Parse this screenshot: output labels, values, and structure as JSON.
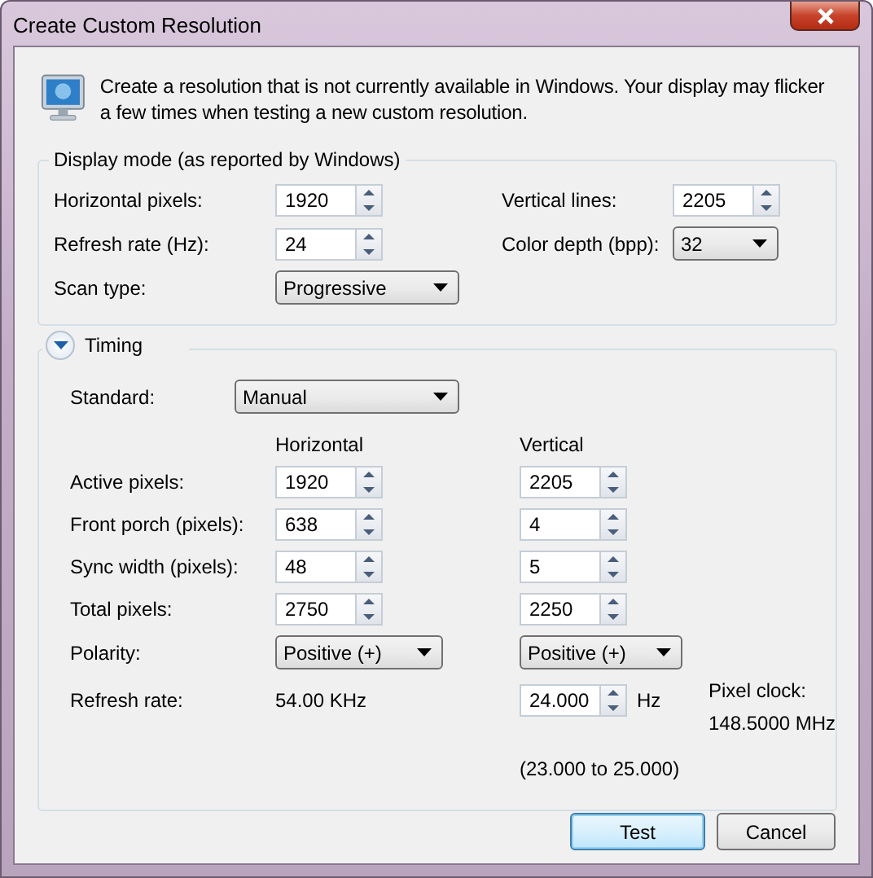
{
  "window": {
    "title": "Create Custom Resolution"
  },
  "intro": "Create a resolution that is not currently available in Windows. Your display may flicker a few times when testing a new custom resolution.",
  "display_mode": {
    "title": "Display mode (as reported by Windows)",
    "fields": [
      {
        "label": "Horizontal pixels:",
        "kind": "spin",
        "value": "1920"
      },
      {
        "label": "Vertical lines:",
        "kind": "spin",
        "value": "2205"
      },
      {
        "label": "Refresh rate (Hz):",
        "kind": "spin",
        "value": "24"
      },
      {
        "label": "Color depth (bpp):",
        "kind": "dropdown",
        "value": "32"
      },
      {
        "label": "Scan type:",
        "kind": "dropdown",
        "value": "Progressive"
      }
    ]
  },
  "timing": {
    "title": "Timing",
    "expanded": true,
    "standard": {
      "label": "Standard:",
      "value": "Manual"
    },
    "column_headers": [
      "Horizontal",
      "Vertical"
    ],
    "rows": [
      {
        "label": "Active pixels:",
        "cells": [
          {
            "kind": "spin",
            "value": "1920"
          },
          {
            "kind": "spin",
            "value": "2205"
          }
        ]
      },
      {
        "label": "Front porch (pixels):",
        "cells": [
          {
            "kind": "spin",
            "value": "638"
          },
          {
            "kind": "spin",
            "value": "4"
          }
        ]
      },
      {
        "label": "Sync width (pixels):",
        "cells": [
          {
            "kind": "spin",
            "value": "48"
          },
          {
            "kind": "spin",
            "value": "5"
          }
        ]
      },
      {
        "label": "Total pixels:",
        "cells": [
          {
            "kind": "spin",
            "value": "2750"
          },
          {
            "kind": "spin",
            "value": "2250"
          }
        ]
      },
      {
        "label": "Polarity:",
        "cells": [
          {
            "kind": "dropdown",
            "value": "Positive (+)"
          },
          {
            "kind": "dropdown",
            "value": "Positive (+)"
          }
        ]
      },
      {
        "label": "Refresh rate:",
        "cells": [
          {
            "kind": "text",
            "value": "54.00 KHz"
          },
          {
            "kind": "spin",
            "value": "24.000",
            "unit": "Hz"
          }
        ]
      }
    ],
    "pixel_clock": {
      "label": "Pixel clock:",
      "value": "148.5000 MHz"
    },
    "range": "(23.000 to 25.000)"
  },
  "buttons": [
    {
      "label": "Test",
      "default": true
    },
    {
      "label": "Cancel",
      "default": false
    }
  ]
}
